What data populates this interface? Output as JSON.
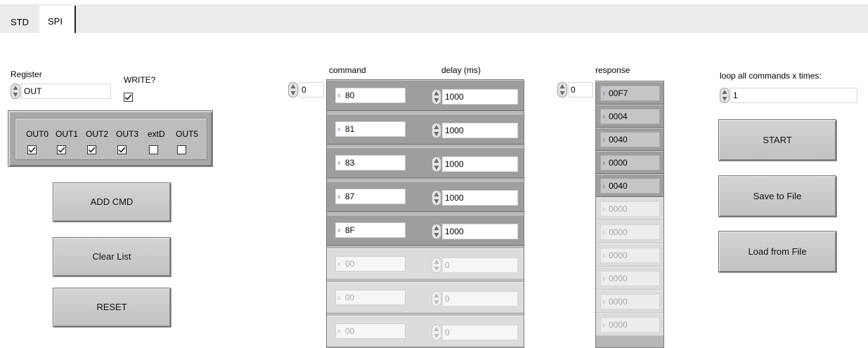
{
  "tabs": [
    {
      "label": "STD",
      "active": false
    },
    {
      "label": "SPI",
      "active": true
    }
  ],
  "register": {
    "label": "Register",
    "value": "OUT",
    "write_label": "WRITE?",
    "write_checked": true
  },
  "outputs": [
    {
      "label": "OUT0",
      "checked": true
    },
    {
      "label": "OUT1",
      "checked": true
    },
    {
      "label": "OUT2",
      "checked": true
    },
    {
      "label": "OUT3",
      "checked": true
    },
    {
      "label": "extD",
      "checked": false
    },
    {
      "label": "OUT5",
      "checked": false
    }
  ],
  "buttons": {
    "add_cmd": "ADD CMD",
    "clear_list": "Clear List",
    "reset": "RESET",
    "start": "START",
    "save_to_file": "Save to File",
    "load_from_file": "Load from File"
  },
  "command_array": {
    "index": "0",
    "command_header": "command",
    "delay_header": "delay (ms)",
    "hex_prefix": "x",
    "rows": [
      {
        "command": "80",
        "delay": "1000",
        "enabled": true
      },
      {
        "command": "81",
        "delay": "1000",
        "enabled": true
      },
      {
        "command": "83",
        "delay": "1000",
        "enabled": true
      },
      {
        "command": "87",
        "delay": "1000",
        "enabled": true
      },
      {
        "command": "8F",
        "delay": "1000",
        "enabled": true
      },
      {
        "command": "00",
        "delay": "0",
        "enabled": false
      },
      {
        "command": "00",
        "delay": "0",
        "enabled": false
      },
      {
        "command": "00",
        "delay": "0",
        "enabled": false
      }
    ]
  },
  "response_array": {
    "index": "0",
    "header": "response",
    "hex_prefix": "x",
    "rows": [
      {
        "value": "00F7",
        "enabled": true
      },
      {
        "value": "0004",
        "enabled": true
      },
      {
        "value": "0040",
        "enabled": true
      },
      {
        "value": "0000",
        "enabled": true
      },
      {
        "value": "0040",
        "enabled": true
      },
      {
        "value": "0000",
        "enabled": false
      },
      {
        "value": "0000",
        "enabled": false
      },
      {
        "value": "0000",
        "enabled": false
      },
      {
        "value": "0000",
        "enabled": false
      },
      {
        "value": "0000",
        "enabled": false
      },
      {
        "value": "0000",
        "enabled": false
      }
    ]
  },
  "loop": {
    "label": "loop all commands x times:",
    "value": "1"
  },
  "icons": {
    "spinner": "up-down-arrows-icon",
    "checkmark": "checkmark-icon"
  }
}
